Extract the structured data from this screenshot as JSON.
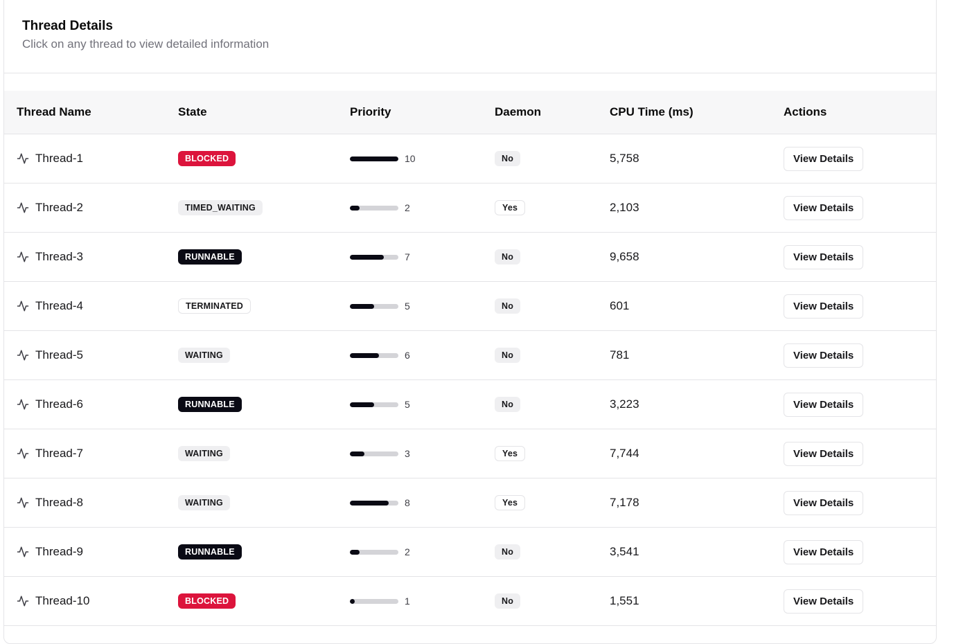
{
  "card": {
    "title": "Thread Details",
    "description": "Click on any thread to view detailed information"
  },
  "columns": [
    "Thread Name",
    "State",
    "Priority",
    "Daemon",
    "CPU Time (ms)",
    "Actions"
  ],
  "colors": {
    "blocked": "#dc143c",
    "runnable": "#0a0a14",
    "muted": "#efeff1",
    "bar_fill": "#0a0a14",
    "bar_track": "#d4d4d8"
  },
  "priority_max": 10,
  "rows": [
    {
      "name": "Thread-1",
      "state": "BLOCKED",
      "state_style": "blocked",
      "priority": 10,
      "daemon": "No",
      "daemon_style": "muted",
      "cpu": "5,758",
      "action": "View Details",
      "icon": "activity-icon"
    },
    {
      "name": "Thread-2",
      "state": "TIMED_WAITING",
      "state_style": "muted",
      "priority": 2,
      "daemon": "Yes",
      "daemon_style": "outline",
      "cpu": "2,103",
      "action": "View Details",
      "icon": "activity-icon"
    },
    {
      "name": "Thread-3",
      "state": "RUNNABLE",
      "state_style": "runnable",
      "priority": 7,
      "daemon": "No",
      "daemon_style": "muted",
      "cpu": "9,658",
      "action": "View Details",
      "icon": "activity-icon"
    },
    {
      "name": "Thread-4",
      "state": "TERMINATED",
      "state_style": "outline",
      "priority": 5,
      "daemon": "No",
      "daemon_style": "muted",
      "cpu": "601",
      "action": "View Details",
      "icon": "activity-icon"
    },
    {
      "name": "Thread-5",
      "state": "WAITING",
      "state_style": "muted",
      "priority": 6,
      "daemon": "No",
      "daemon_style": "muted",
      "cpu": "781",
      "action": "View Details",
      "icon": "activity-icon"
    },
    {
      "name": "Thread-6",
      "state": "RUNNABLE",
      "state_style": "runnable",
      "priority": 5,
      "daemon": "No",
      "daemon_style": "muted",
      "cpu": "3,223",
      "action": "View Details",
      "icon": "activity-icon"
    },
    {
      "name": "Thread-7",
      "state": "WAITING",
      "state_style": "muted",
      "priority": 3,
      "daemon": "Yes",
      "daemon_style": "outline",
      "cpu": "7,744",
      "action": "View Details",
      "icon": "activity-icon"
    },
    {
      "name": "Thread-8",
      "state": "WAITING",
      "state_style": "muted",
      "priority": 8,
      "daemon": "Yes",
      "daemon_style": "outline",
      "cpu": "7,178",
      "action": "View Details",
      "icon": "activity-icon"
    },
    {
      "name": "Thread-9",
      "state": "RUNNABLE",
      "state_style": "runnable",
      "priority": 2,
      "daemon": "No",
      "daemon_style": "muted",
      "cpu": "3,541",
      "action": "View Details",
      "icon": "activity-icon"
    },
    {
      "name": "Thread-10",
      "state": "BLOCKED",
      "state_style": "blocked",
      "priority": 1,
      "daemon": "No",
      "daemon_style": "muted",
      "cpu": "1,551",
      "action": "View Details",
      "icon": "activity-icon"
    }
  ]
}
